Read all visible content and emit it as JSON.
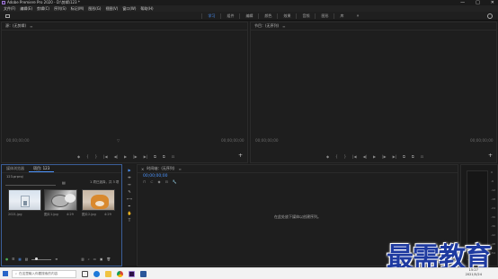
{
  "title_bar": {
    "title": "Adobe Premiere Pro 2020 - D:\\剪辑\\123 *",
    "controls": [
      "—",
      "□",
      "✕"
    ]
  },
  "menu": [
    "文件(F)",
    "编辑(E)",
    "剪辑(C)",
    "序列(S)",
    "标记(M)",
    "图形(G)",
    "视图(V)",
    "窗口(W)",
    "帮助(H)"
  ],
  "workspace": {
    "tabs": [
      "学习",
      "组件",
      "编辑",
      "颜色",
      "效果",
      "音频",
      "图形",
      "库"
    ],
    "active_index": 0,
    "more": "»"
  },
  "source_monitor": {
    "title": "源：(无剪辑)",
    "menu": "≡",
    "tc_left": "00;00;00;00",
    "tc_right": "00;00;00;00",
    "zoom": "▽"
  },
  "program_monitor": {
    "title": "节目：(无序列)",
    "menu": "≡",
    "tc_left": "00;00;00;00",
    "tc_right": "00;00;00;00"
  },
  "transport": [
    "◆",
    "{",
    "}",
    "|◀",
    "◀|",
    "▶",
    "|▶",
    "▶|",
    "⧉",
    "⧉",
    "⊡"
  ],
  "project": {
    "tabs": [
      "媒体浏览器",
      "项目: 123"
    ],
    "active_tab": 1,
    "path": "123.prproj",
    "selection": "1 项已选择，共 3 项",
    "clips": [
      {
        "name": "2021.jpg",
        "duration": ""
      },
      {
        "name": "图片1.jpg",
        "duration": "4:29"
      },
      {
        "name": "图片2.jpg",
        "duration": "4:29"
      }
    ]
  },
  "timeline": {
    "title": "时间轴：(无序列)",
    "timecode": "00;00;00;00",
    "empty_message": "在此处放下媒体以创建序列。"
  },
  "tools": [
    "▶",
    "⇹",
    "↔",
    "✎",
    "⟷",
    "✒",
    "✋",
    "T"
  ],
  "meter": {
    "scale": [
      "0",
      "-6",
      "-12",
      "-18",
      "-24",
      "-30",
      "-36",
      "-42",
      "-48",
      "-54"
    ]
  },
  "taskbar": {
    "search_placeholder": "在这里输入你要搜索的内容",
    "time": "15:27",
    "date": "2021/5/24"
  },
  "watermark": "最需教育",
  "colors": {
    "accent": "#4d96ff",
    "panel": "#1e1e1e",
    "taskbar": "#f2f2f2",
    "watermark": "#1e3aa0"
  }
}
